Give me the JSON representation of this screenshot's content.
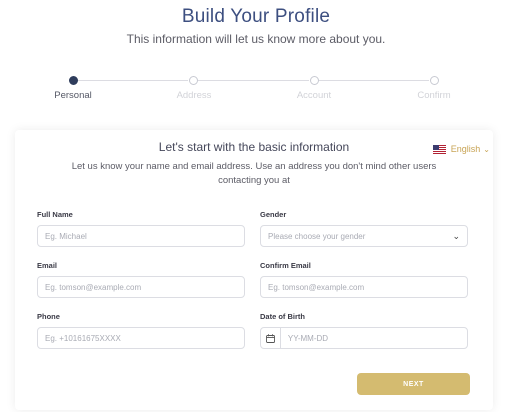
{
  "header": {
    "title": "Build Your Profile",
    "subtitle": "This information will let us know more about you."
  },
  "stepper": {
    "steps": [
      {
        "label": "Personal",
        "active": true
      },
      {
        "label": "Address",
        "active": false
      },
      {
        "label": "Account",
        "active": false
      },
      {
        "label": "Confirm",
        "active": false
      }
    ]
  },
  "card": {
    "title": "Let's start with the basic information",
    "description": "Let us know your name and email address. Use an address you don't mind other users contacting you at",
    "language": {
      "label": "English",
      "flag_icon": "us-flag-icon",
      "chevron_icon": "chevron-down-icon"
    },
    "fields": {
      "full_name": {
        "label": "Full Name",
        "placeholder": "Eg. Michael",
        "value": ""
      },
      "gender": {
        "label": "Gender",
        "placeholder": "Please choose your gender",
        "value": ""
      },
      "email": {
        "label": "Email",
        "placeholder": "Eg. tomson@example.com",
        "value": ""
      },
      "confirm_email": {
        "label": "Confirm Email",
        "placeholder": "Eg. tomson@example.com",
        "value": ""
      },
      "phone": {
        "label": "Phone",
        "placeholder": "Eg. +10161675XXXX",
        "value": ""
      },
      "dob": {
        "label": "Date of Birth",
        "placeholder": "YY-MM-DD",
        "value": "",
        "icon": "calendar-icon"
      }
    },
    "next_label": "NEXT"
  },
  "colors": {
    "title": "#3d4f80",
    "accent_gold": "#d4bb70",
    "active_step": "#2f3d5c"
  }
}
